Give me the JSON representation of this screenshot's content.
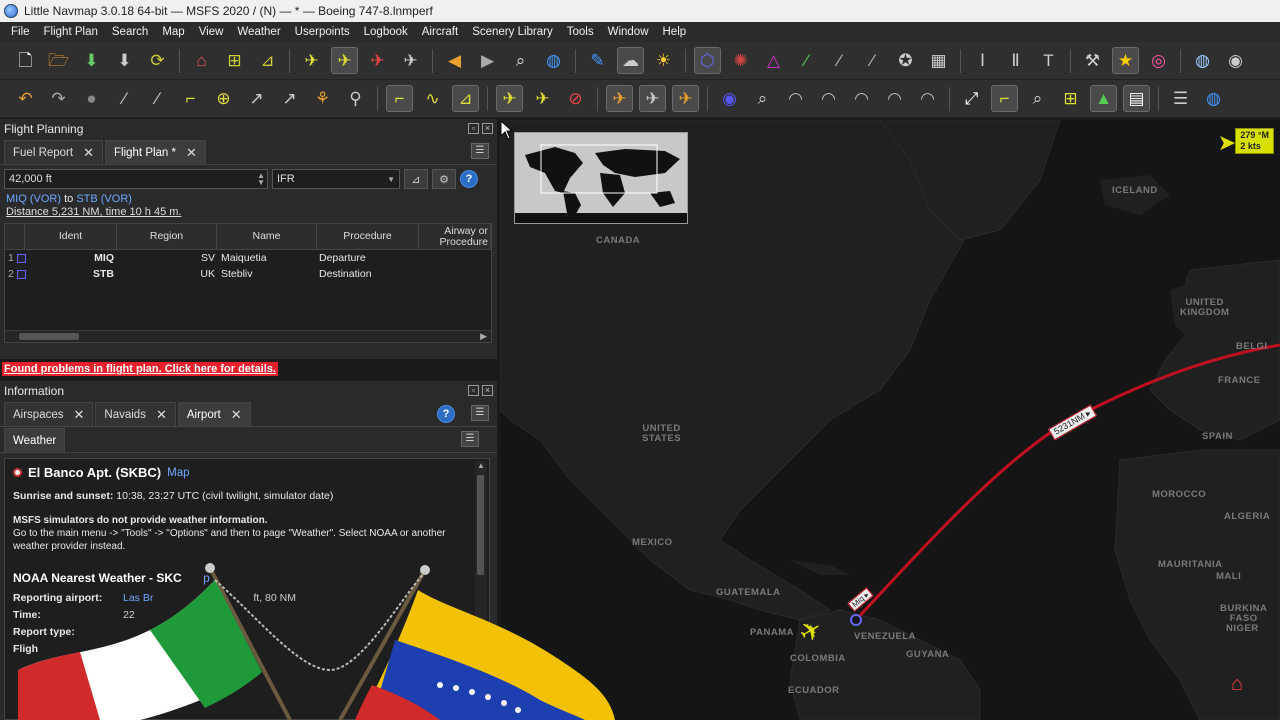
{
  "window": {
    "title": "Little Navmap 3.0.18 64-bit — MSFS 2020 / (N) — * — Boeing 747-8.lnmperf"
  },
  "menu": [
    "File",
    "Flight Plan",
    "Search",
    "Map",
    "View",
    "Weather",
    "Userpoints",
    "Logbook",
    "Aircraft",
    "Scenery Library",
    "Tools",
    "Window",
    "Help"
  ],
  "flight_planning": {
    "title": "Flight Planning",
    "tabs": [
      {
        "label": "Fuel Report"
      },
      {
        "label": "Flight Plan *"
      }
    ],
    "altitude": "42,000 ft",
    "type": "IFR",
    "route_from": "MIQ (VOR)",
    "route_to_word": "to",
    "route_to": "STB (VOR)",
    "distance": "Distance 5,231 NM, time 10 h 45 m.",
    "columns": [
      "Ident",
      "Region",
      "Name",
      "Procedure",
      "Airway or Procedure"
    ],
    "rows": [
      {
        "num": "1",
        "ident": "MIQ",
        "region": "SV",
        "name": "Maiquetia",
        "procedure": "Departure"
      },
      {
        "num": "2",
        "ident": "STB",
        "region": "UK",
        "name": "Stebliv",
        "procedure": "Destination"
      }
    ],
    "problem": "Found problems in flight plan. Click here for details."
  },
  "information": {
    "title": "Information",
    "tabs": [
      {
        "label": "Airspaces"
      },
      {
        "label": "Navaids"
      },
      {
        "label": "Airport"
      }
    ],
    "subtab": "Weather",
    "airport_name": "El Banco Apt. (SKBC)",
    "map_link": "Map",
    "sunrise_label": "Sunrise and sunset:",
    "sunrise_value": "10:38, 23:27 UTC (civil twilight, simulator date)",
    "msfs_bold": "MSFS simulators do not provide weather information.",
    "msfs_text": "Go to the main menu -> \"Tools\" -> \"Options\" and then to page \"Weather\". Select NOAA or another weather provider instead.",
    "noaa_title": "NOAA Nearest Weather - SKC",
    "noaa_map": "p",
    "wx": [
      {
        "k": "Reporting airport:",
        "v": "Las Br",
        "v2": "ft, 80 NM"
      },
      {
        "k": "Time:",
        "v": "22"
      },
      {
        "k": "Report type:",
        "v": ""
      },
      {
        "k": "Fligh",
        "v": ""
      }
    ]
  },
  "map": {
    "labels": {
      "canada": "CANADA",
      "iceland": "ICELAND",
      "uk": "UNITED\nKINGDOM",
      "france": "FRANCE",
      "spain": "SPAIN",
      "morocco": "MOROCCO",
      "algeria": "ALGERIA",
      "us": "UNITED\nSTATES",
      "mexico": "MEXICO",
      "guatemala": "GUATEMALA",
      "panama": "PANAMA",
      "venezuela": "VENEZUELA",
      "colombia": "COLOMBIA",
      "guyana": "GUYANA",
      "ecuador": "ECUADOR",
      "mauritania": "MAURITANIA",
      "mali": "MALI",
      "niger": "NIGER",
      "burkina": "BURKINA\nFASO",
      "belgium": "BELGI"
    },
    "route_label": "5231NM ▸",
    "start_label": "Miq ▸",
    "wind": "279 °M\n2 kts",
    "colors": {
      "route": "#c01020",
      "aircraft": "#e0e000"
    }
  }
}
